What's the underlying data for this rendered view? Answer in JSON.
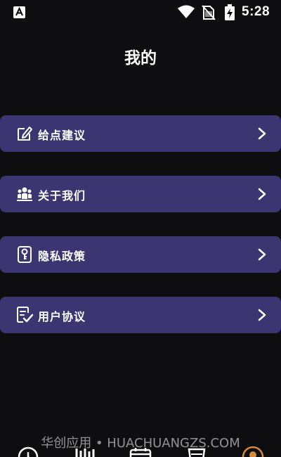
{
  "status_bar": {
    "time": "5:28",
    "left_icon": "text-a-icon",
    "icons": [
      "wifi-icon",
      "no-sim-icon",
      "battery-charging-icon"
    ]
  },
  "header": {
    "title": "我的"
  },
  "menu": {
    "items": [
      {
        "label": "给点建议",
        "icon": "edit-icon"
      },
      {
        "label": "关于我们",
        "icon": "group-icon"
      },
      {
        "label": "隐私政策",
        "icon": "key-icon"
      },
      {
        "label": "用户协议",
        "icon": "checklist-icon"
      }
    ]
  },
  "watermark": {
    "text": "华创应用 • HUACHUANGZS.COM"
  },
  "bottom_nav": {
    "icons": [
      "clock-icon",
      "chart-icon",
      "calendar-icon",
      "cup-icon",
      "profile-icon"
    ],
    "active_color": "#d88a3c"
  },
  "colors": {
    "background": "#0e0d0f",
    "card": "#3b3672",
    "text": "#ffffff"
  }
}
